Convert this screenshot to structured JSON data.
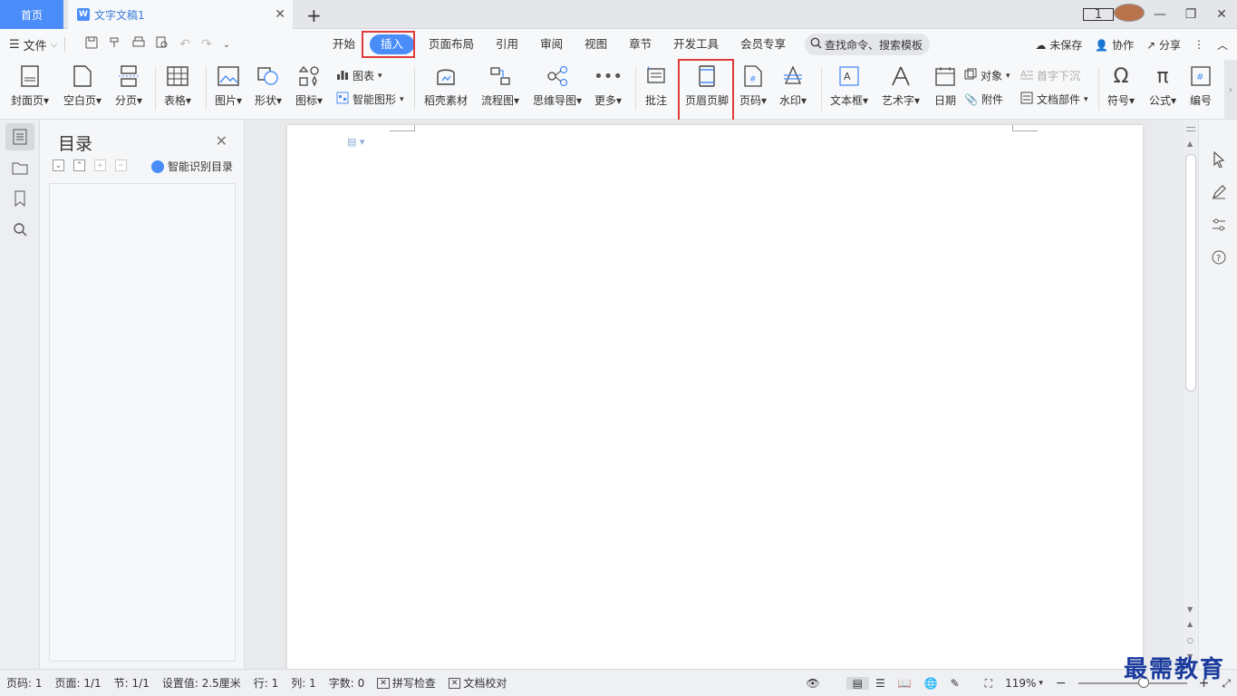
{
  "titlebar": {
    "home_tab": "首页",
    "doc_tab": "文字文稿1",
    "doc_icon_letter": "W",
    "close_glyph": "✕",
    "add_glyph": "+",
    "page_count_badge": "1"
  },
  "menu": {
    "file_label": "文件",
    "tabs": [
      "开始",
      "插入",
      "页面布局",
      "引用",
      "审阅",
      "视图",
      "章节",
      "开发工具",
      "会员专享"
    ],
    "active_tab": "插入",
    "search_placeholder": "查找命令、搜索模板",
    "unsaved": "未保存",
    "collab": "协作",
    "share": "分享"
  },
  "ribbon": {
    "cover": "封面页",
    "blank": "空白页",
    "break": "分页",
    "table": "表格",
    "picture": "图片",
    "shape": "形状",
    "icon": "图标",
    "chart": "图表",
    "smart": "智能图形",
    "straw": "稻壳素材",
    "flow": "流程图",
    "mind": "思维导图",
    "more": "更多",
    "comment": "批注",
    "header_footer": "页眉页脚",
    "page_num": "页码",
    "watermark": "水印",
    "textbox": "文本框",
    "art": "艺术字",
    "date": "日期",
    "object": "对象",
    "dropcap": "首字下沉",
    "attach": "附件",
    "docpart": "文档部件",
    "symbol": "符号",
    "formula": "公式",
    "numbering": "编号"
  },
  "toc": {
    "title": "目录",
    "smart_recognize": "智能识别目录"
  },
  "status": {
    "page": "页码: 1",
    "pages": "页面: 1/1",
    "section": "节: 1/1",
    "setting": "设置值: 2.5厘米",
    "row": "行: 1",
    "col": "列: 1",
    "words": "字数: 0",
    "spell": "拼写检查",
    "proof": "文档校对",
    "zoom": "119%"
  },
  "watermark_text": "最需教育",
  "colors": {
    "accent": "#4b8df8",
    "highlight_box": "#e03a3a"
  }
}
